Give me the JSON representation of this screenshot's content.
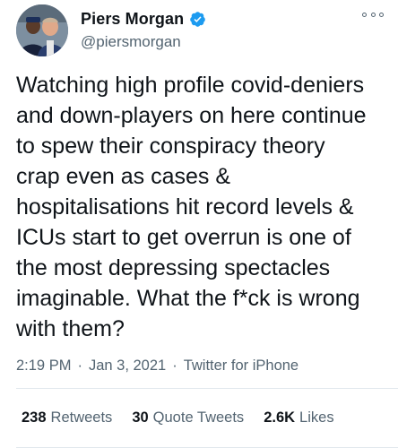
{
  "author": {
    "display_name": "Piers Morgan",
    "handle": "@piersmorgan",
    "verified": true,
    "avatar_icon": "profile-photo",
    "verified_icon": "verified-badge-icon",
    "verified_color": "#1d9bf0"
  },
  "more_icon": "more-options-icon",
  "tweet": {
    "text": "Watching high profile covid-deniers\nand down-players on here continue\nto spew their conspiracy theory\ncrap even as cases &\nhospitalisations hit record levels &\nICUs start to get overrun is one of\nthe most depressing spectacles\nimaginable. What the f*ck is wrong\nwith them?"
  },
  "meta": {
    "time": "2:19 PM",
    "separator": "·",
    "date": "Jan 3, 2021",
    "source": "Twitter for iPhone"
  },
  "stats": {
    "retweets_count": "238",
    "retweets_label": "Retweets",
    "quote_tweets_count": "30",
    "quote_tweets_label": "Quote Tweets",
    "likes_count": "2.6K",
    "likes_label": "Likes"
  },
  "colors": {
    "text_primary": "#0f1419",
    "text_secondary": "#536471",
    "divider": "#e1e8ed"
  }
}
